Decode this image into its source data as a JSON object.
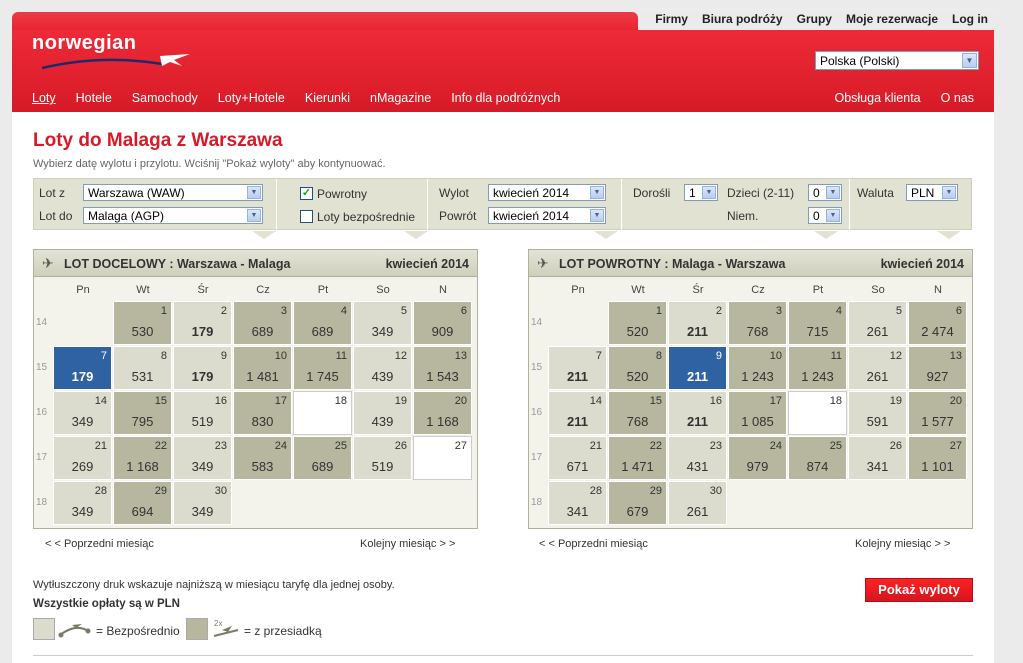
{
  "util_links": [
    "Firmy",
    "Biura podróży",
    "Grupy",
    "Moje rezerwacje",
    "Log in"
  ],
  "logo": "norwegian",
  "language": "Polska (Polski)",
  "nav_left": [
    {
      "label": "Loty",
      "active": true
    },
    {
      "label": "Hotele"
    },
    {
      "label": "Samochody"
    },
    {
      "label": "Loty+Hotele"
    },
    {
      "label": "Kierunki"
    },
    {
      "label": "nMagazine"
    },
    {
      "label": "Info dla podróżnych"
    }
  ],
  "nav_right": [
    "Obsługa klienta",
    "O nas"
  ],
  "page": {
    "title": "Loty do Malaga z Warszawa",
    "subtitle": "Wybierz datę wylotu i przylotu. Wciśnij \"Pokaż wyloty\" aby kontynuować."
  },
  "search": {
    "from_label": "Lot z",
    "from_value": "Warszawa (WAW)",
    "to_label": "Lot do",
    "to_value": "Malaga (AGP)",
    "return_label": "Powrotny",
    "return_checked": true,
    "direct_label": "Loty bezpośrednie",
    "direct_checked": false,
    "dep_label": "Wylot",
    "dep_value": "kwiecień 2014",
    "ret_label": "Powrót",
    "ret_value": "kwiecień 2014",
    "adults_label": "Dorośli",
    "adults_value": "1",
    "children_label": "Dzieci (2-11)",
    "children_value": "0",
    "infants_label": "Niem.",
    "infants_value": "0",
    "currency_label": "Waluta",
    "currency_value": "PLN"
  },
  "days_of_week": [
    "Pn",
    "Wt",
    "Śr",
    "Cz",
    "Pt",
    "So",
    "N"
  ],
  "week_numbers": [
    "14",
    "15",
    "16",
    "17",
    "18"
  ],
  "outbound": {
    "title": "LOT DOCELOWY :  Warszawa - Malaga",
    "month": "kwiecień 2014",
    "days": [
      {
        "d": "1",
        "p": "530",
        "t": "d"
      },
      {
        "d": "2",
        "p": "179",
        "t": "n",
        "b": true
      },
      {
        "d": "3",
        "p": "689",
        "t": "d"
      },
      {
        "d": "4",
        "p": "689",
        "t": "d"
      },
      {
        "d": "5",
        "p": "349",
        "t": "n"
      },
      {
        "d": "6",
        "p": "909",
        "t": "d"
      },
      {
        "d": "7",
        "p": "179",
        "t": "s",
        "b": true
      },
      {
        "d": "8",
        "p": "531",
        "t": "n"
      },
      {
        "d": "9",
        "p": "179",
        "t": "n",
        "b": true
      },
      {
        "d": "10",
        "p": "1 481",
        "t": "d"
      },
      {
        "d": "11",
        "p": "1 745",
        "t": "d"
      },
      {
        "d": "12",
        "p": "439",
        "t": "n"
      },
      {
        "d": "13",
        "p": "1 543",
        "t": "d"
      },
      {
        "d": "14",
        "p": "349",
        "t": "n"
      },
      {
        "d": "15",
        "p": "795",
        "t": "d"
      },
      {
        "d": "16",
        "p": "519",
        "t": "n"
      },
      {
        "d": "17",
        "p": "830",
        "t": "d"
      },
      {
        "d": "18",
        "p": "",
        "t": "e"
      },
      {
        "d": "19",
        "p": "439",
        "t": "n"
      },
      {
        "d": "20",
        "p": "1 168",
        "t": "d"
      },
      {
        "d": "21",
        "p": "269",
        "t": "n"
      },
      {
        "d": "22",
        "p": "1 168",
        "t": "d"
      },
      {
        "d": "23",
        "p": "349",
        "t": "n"
      },
      {
        "d": "24",
        "p": "583",
        "t": "d"
      },
      {
        "d": "25",
        "p": "689",
        "t": "d"
      },
      {
        "d": "26",
        "p": "519",
        "t": "n"
      },
      {
        "d": "27",
        "p": "",
        "t": "e"
      },
      {
        "d": "28",
        "p": "349",
        "t": "n"
      },
      {
        "d": "29",
        "p": "694",
        "t": "d"
      },
      {
        "d": "30",
        "p": "349",
        "t": "n"
      }
    ],
    "prev": "< < Poprzedni miesiąc",
    "next": "Kolejny miesiąc > >"
  },
  "return": {
    "title": "LOT POWROTNY :  Malaga - Warszawa",
    "month": "kwiecień 2014",
    "days": [
      {
        "d": "1",
        "p": "520",
        "t": "d"
      },
      {
        "d": "2",
        "p": "211",
        "t": "n",
        "b": true
      },
      {
        "d": "3",
        "p": "768",
        "t": "d"
      },
      {
        "d": "4",
        "p": "715",
        "t": "d"
      },
      {
        "d": "5",
        "p": "261",
        "t": "n"
      },
      {
        "d": "6",
        "p": "2 474",
        "t": "d"
      },
      {
        "d": "7",
        "p": "211",
        "t": "n",
        "b": true
      },
      {
        "d": "8",
        "p": "520",
        "t": "d"
      },
      {
        "d": "9",
        "p": "211",
        "t": "s",
        "b": true
      },
      {
        "d": "10",
        "p": "1 243",
        "t": "d"
      },
      {
        "d": "11",
        "p": "1 243",
        "t": "d"
      },
      {
        "d": "12",
        "p": "261",
        "t": "n"
      },
      {
        "d": "13",
        "p": "927",
        "t": "d"
      },
      {
        "d": "14",
        "p": "211",
        "t": "n",
        "b": true
      },
      {
        "d": "15",
        "p": "768",
        "t": "d"
      },
      {
        "d": "16",
        "p": "211",
        "t": "n",
        "b": true
      },
      {
        "d": "17",
        "p": "1 085",
        "t": "d"
      },
      {
        "d": "18",
        "p": "",
        "t": "e"
      },
      {
        "d": "19",
        "p": "591",
        "t": "n"
      },
      {
        "d": "20",
        "p": "1 577",
        "t": "d"
      },
      {
        "d": "21",
        "p": "671",
        "t": "n"
      },
      {
        "d": "22",
        "p": "1 471",
        "t": "d"
      },
      {
        "d": "23",
        "p": "431",
        "t": "n"
      },
      {
        "d": "24",
        "p": "979",
        "t": "d"
      },
      {
        "d": "25",
        "p": "874",
        "t": "d"
      },
      {
        "d": "26",
        "p": "341",
        "t": "n"
      },
      {
        "d": "27",
        "p": "1 101",
        "t": "d"
      },
      {
        "d": "28",
        "p": "341",
        "t": "n"
      },
      {
        "d": "29",
        "p": "679",
        "t": "d"
      },
      {
        "d": "30",
        "p": "261",
        "t": "n"
      }
    ],
    "prev": "< < Poprzedni miesiąc",
    "next": "Kolejny miesiąc > >"
  },
  "legend": {
    "info": "Wytłuszczony druk wskazuje najniższą w miesiącu taryfę dla jednej osoby.",
    "currency_note": "Wszystkie opłaty są w PLN",
    "direct": "= Bezpośrednio",
    "connecting": "= z przesiadką",
    "connecting_badge": "2x"
  },
  "show_button": "Pokaż wyloty",
  "colors": {
    "brand_red": "#d71a27",
    "selected_blue": "#2f62a2",
    "direct_cell": "#dcdcce",
    "connecting_cell": "#b7b7a0"
  }
}
